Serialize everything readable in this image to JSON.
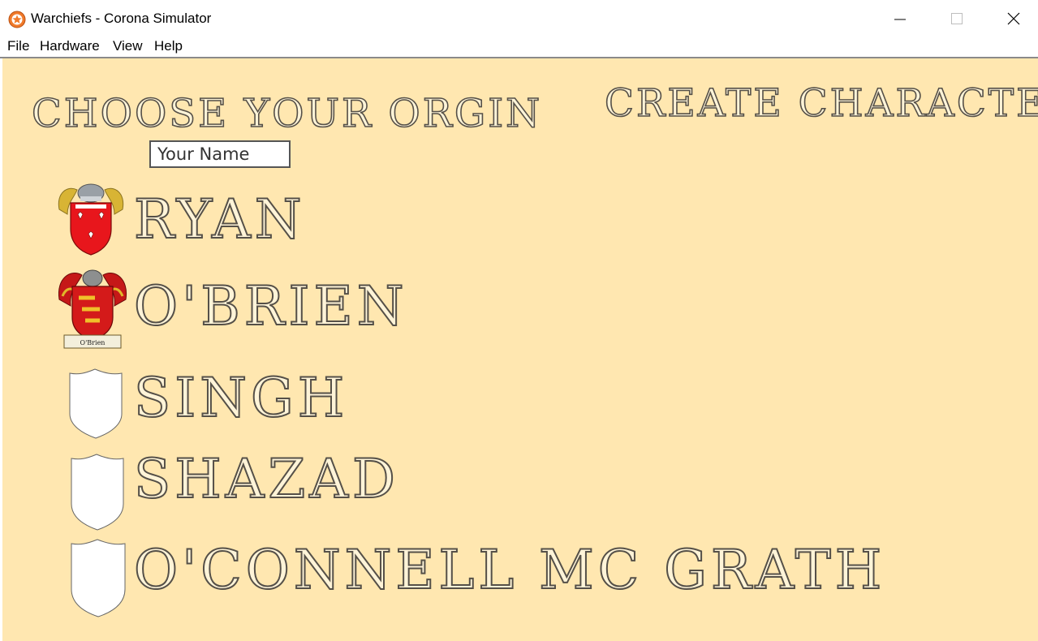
{
  "window": {
    "title": "Warchiefs - Corona Simulator",
    "controls": [
      "minimize",
      "maximize",
      "close"
    ]
  },
  "menu": [
    {
      "label": "File"
    },
    {
      "label": "Hardware"
    },
    {
      "label": "View"
    },
    {
      "label": "Help"
    }
  ],
  "screen": {
    "background": "#ffe7b0",
    "heading_left": "CHOOSE YOUR ORGIN",
    "heading_right": "CREATE CHARACTER",
    "name_input": {
      "placeholder": "Your Name",
      "value": ""
    }
  },
  "origins": [
    {
      "name": "RYAN",
      "crest": "ryan-coat-of-arms-icon"
    },
    {
      "name": "O'BRIEN",
      "crest": "obrien-coat-of-arms-icon",
      "crest_caption": "O'Brien"
    },
    {
      "name": "SINGH",
      "crest": "blank-shield-icon"
    },
    {
      "name": "SHAZAD",
      "crest": "blank-shield-icon"
    },
    {
      "name": "O'CONNELL MC GRATH",
      "crest": "blank-shield-icon"
    }
  ]
}
